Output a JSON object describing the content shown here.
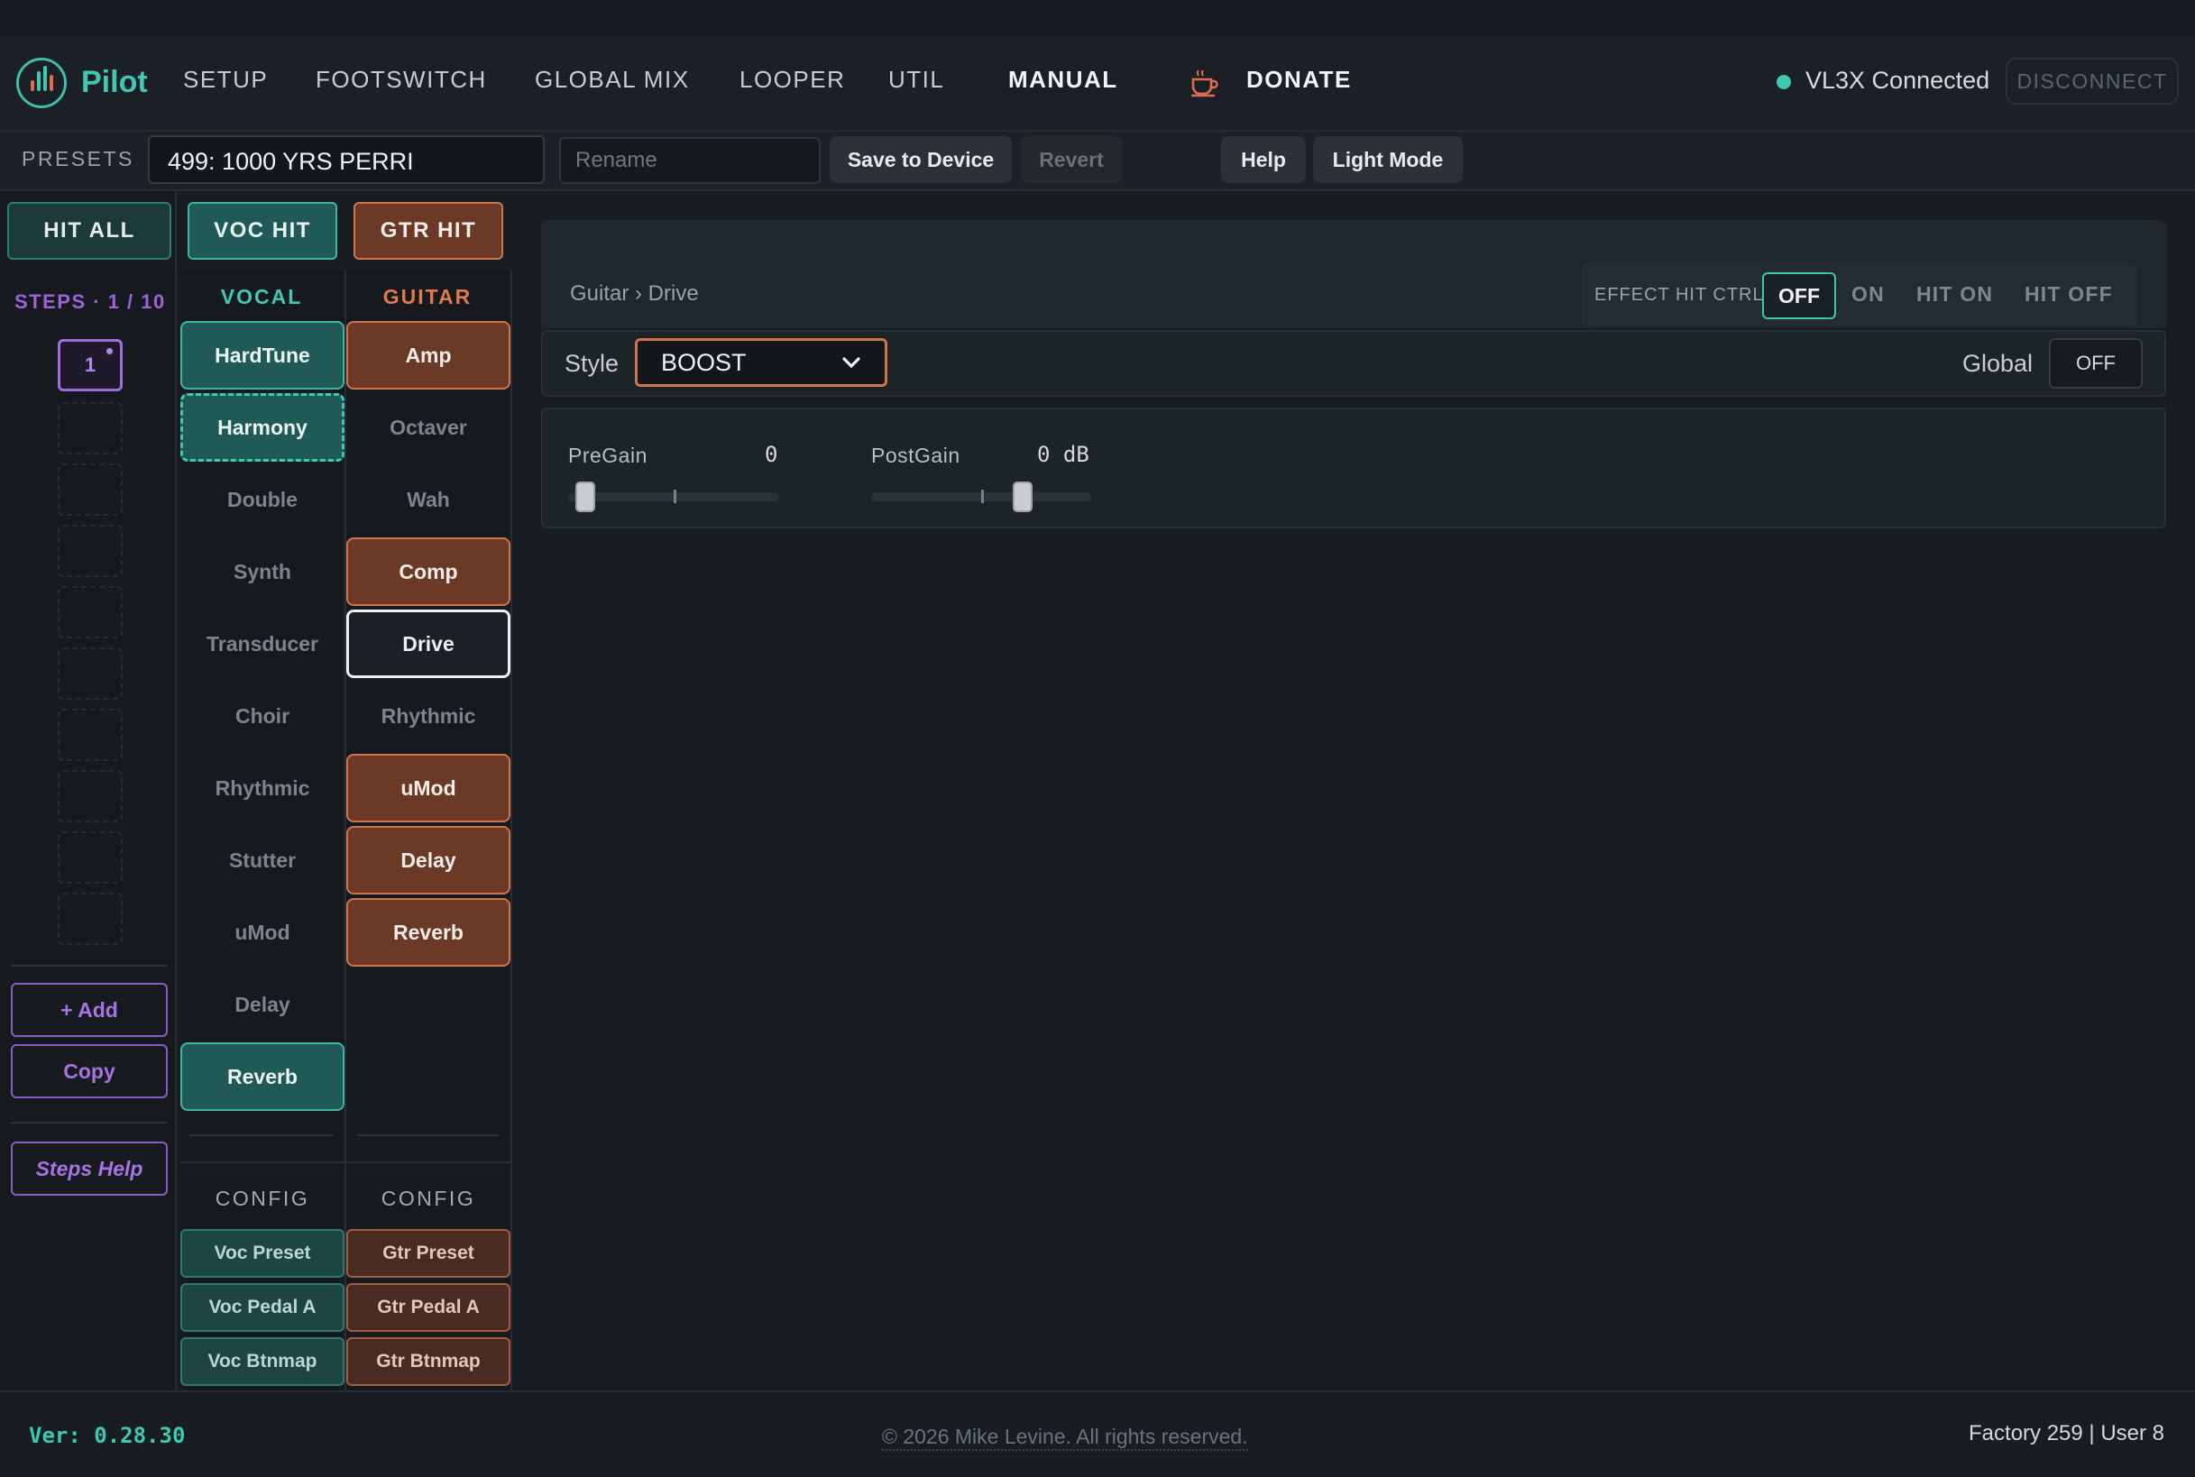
{
  "app": {
    "name": "Pilot"
  },
  "nav": {
    "items": [
      "SETUP",
      "FOOTSWITCH",
      "GLOBAL MIX",
      "LOOPER",
      "UTIL",
      "MANUAL"
    ],
    "active": "MANUAL",
    "donate": "DONATE"
  },
  "connection": {
    "status": "VL3X Connected",
    "disconnect": "DISCONNECT"
  },
  "presets": {
    "label": "PRESETS",
    "current": "499: 1000 YRS PERRI",
    "rename_placeholder": "Rename",
    "save": "Save to Device",
    "revert": "Revert",
    "help": "Help",
    "light_mode": "Light Mode"
  },
  "hit": {
    "all": "HIT ALL",
    "voc": "VOC HIT",
    "gtr": "GTR HIT"
  },
  "steps": {
    "label": "STEPS · 1 / 10",
    "active_step": "1",
    "add": "+ Add",
    "copy": "Copy",
    "help": "Steps Help"
  },
  "vocal": {
    "header": "VOCAL",
    "effects": [
      "HardTune",
      "Harmony",
      "Double",
      "Synth",
      "Transducer",
      "Choir",
      "Rhythmic",
      "Stutter",
      "uMod",
      "Delay",
      "Reverb"
    ],
    "config_label": "CONFIG",
    "config": [
      "Voc Preset",
      "Voc Pedal A",
      "Voc Btnmap"
    ]
  },
  "guitar": {
    "header": "GUITAR",
    "effects": [
      "Amp",
      "Octaver",
      "Wah",
      "Comp",
      "Drive",
      "Rhythmic",
      "uMod",
      "Delay",
      "Reverb"
    ],
    "config_label": "CONFIG",
    "config": [
      "Gtr Preset",
      "Gtr Pedal A",
      "Gtr Btnmap"
    ]
  },
  "editor": {
    "breadcrumb": "Guitar › Drive",
    "effect_hit_ctrl": {
      "label": "EFFECT HIT CTRL:",
      "options": [
        "OFF",
        "ON",
        "HIT ON",
        "HIT OFF"
      ],
      "active": "OFF"
    },
    "style_label": "Style",
    "style_value": "BOOST",
    "global_label": "Global",
    "global_value": "OFF",
    "params": [
      {
        "label": "PreGain",
        "value": "0",
        "level": 0.08
      },
      {
        "label": "PostGain",
        "value": "0 dB",
        "level": 0.69
      }
    ]
  },
  "footer": {
    "version": "Ver: 0.28.30",
    "copyright": "© 2026 Mike Levine. All rights reserved.",
    "counts": "Factory 259 | User 8"
  },
  "colors": {
    "vocal_accent": "#3fc8b4",
    "guitar_accent": "#e07a4a",
    "steps_accent": "#a06ce0",
    "connected": "#3fc8b0"
  }
}
